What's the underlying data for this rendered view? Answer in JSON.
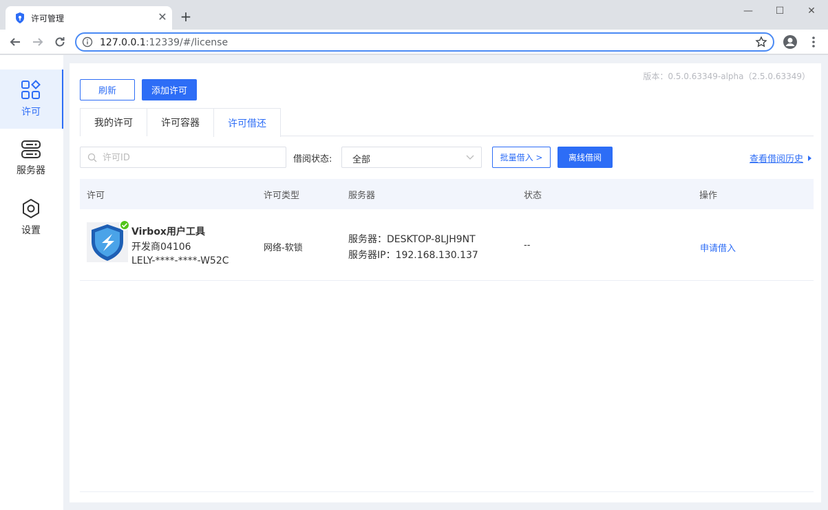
{
  "browser": {
    "tab_title": "许可管理",
    "url_host": "127.0.0.1",
    "url_path": ":12339/#/license"
  },
  "sidebar": {
    "items": [
      {
        "label": "许可",
        "icon": "apps-icon",
        "active": true
      },
      {
        "label": "服务器",
        "icon": "server-icon",
        "active": false
      },
      {
        "label": "设置",
        "icon": "gear-icon",
        "active": false
      }
    ]
  },
  "header": {
    "version": "版本：0.5.0.63349-alpha（2.5.0.63349）",
    "refresh_label": "刷新",
    "add_license_label": "添加许可"
  },
  "tabs": [
    {
      "label": "我的许可",
      "active": false
    },
    {
      "label": "许可容器",
      "active": false
    },
    {
      "label": "许可借还",
      "active": true
    }
  ],
  "filters": {
    "search_placeholder": "许可ID",
    "status_label": "借阅状态:",
    "status_value": "全部",
    "batch_label": "批量借入 >",
    "offline_label": "离线借阅",
    "history_label": "查看借阅历史"
  },
  "table": {
    "columns": [
      "许可",
      "许可类型",
      "服务器",
      "状态",
      "操作"
    ],
    "rows": [
      {
        "name": "Virbox用户工具",
        "developer": "开发商04106",
        "license_id": "LELY-****-****-W52C",
        "type": "网络-软锁",
        "server": "服务器：DESKTOP-8LJH9NT",
        "server_ip": "服务器IP：192.168.130.137",
        "status": "--",
        "action": "申请借入"
      }
    ]
  },
  "colors": {
    "accent": "#2d6df6",
    "success": "#52c41a"
  }
}
